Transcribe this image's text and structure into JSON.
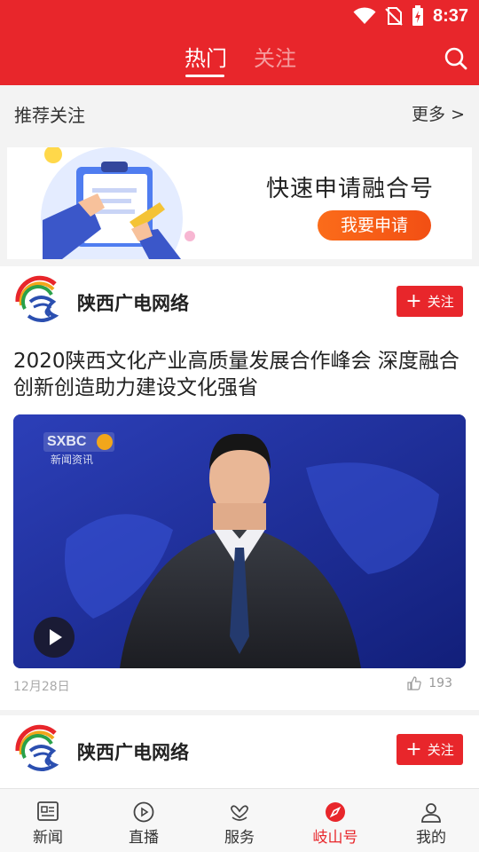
{
  "status_bar": {
    "time": "8:37"
  },
  "header": {
    "tabs": [
      {
        "label": "热门",
        "active": true
      },
      {
        "label": "关注",
        "active": false
      }
    ],
    "icons": {
      "search": "search-icon"
    }
  },
  "recommend": {
    "title": "推荐关注",
    "more": "更多 >"
  },
  "banner": {
    "title": "快速申请融合号",
    "button": "我要申请"
  },
  "feed": [
    {
      "author": "陕西广电网络",
      "follow": "关注",
      "headline": "2020陕西文化产业高质量发展合作峰会 深度融合创新创造助力建设文化强省",
      "video": {
        "channel_logo": "SXBC",
        "channel_caption": "新闻资讯"
      },
      "date": "12月28日",
      "likes": "193"
    },
    {
      "author": "陕西广电网络",
      "follow": "关注"
    }
  ],
  "nav": [
    {
      "label": "新闻",
      "icon": "newspaper-icon"
    },
    {
      "label": "直播",
      "icon": "play-circle-icon"
    },
    {
      "label": "服务",
      "icon": "service-heart-icon"
    },
    {
      "label": "岐山号",
      "icon": "compass-icon",
      "active": true
    },
    {
      "label": "我的",
      "icon": "person-icon"
    }
  ],
  "colors": {
    "brand_red": "#e8262b",
    "banner_orange": "#f55a16"
  }
}
